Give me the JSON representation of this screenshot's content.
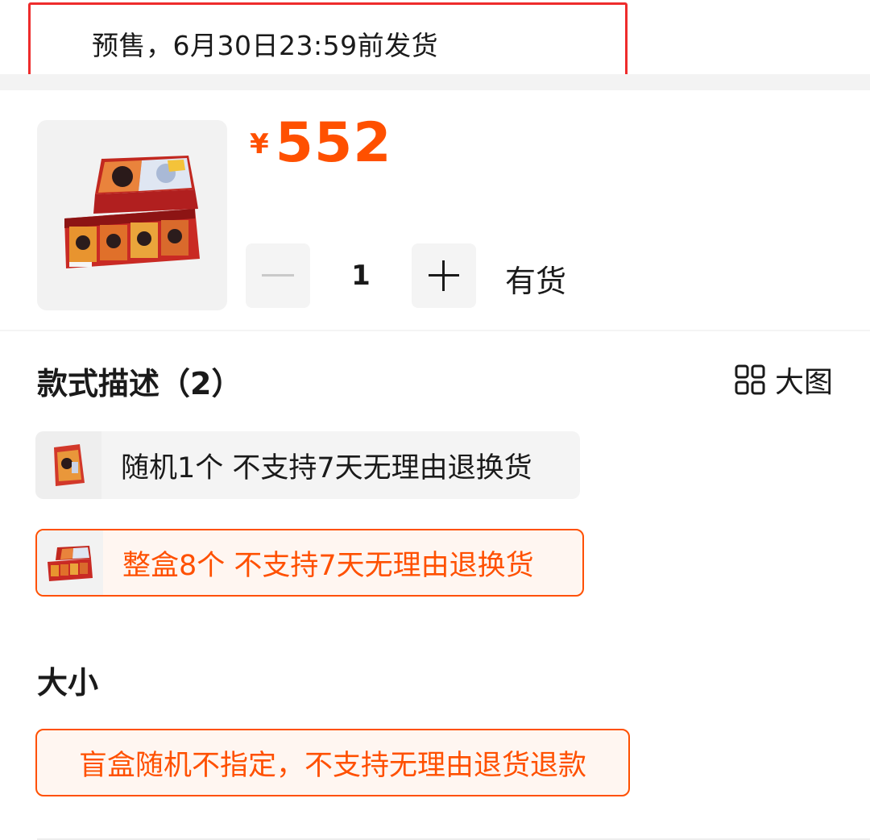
{
  "presale": {
    "text": "预售，6月30日23:59前发货"
  },
  "product": {
    "currency": "¥",
    "price": "552",
    "quantity": "1",
    "stock_status": "有货",
    "accent_color": "#ff5000"
  },
  "style_section": {
    "title": "款式描述（2）",
    "big_view_label": "大图",
    "big_view_icon": "grid-icon",
    "options": [
      {
        "label": "随机1个 不支持7天无理由退换货",
        "selected": false
      },
      {
        "label": "整盒8个 不支持7天无理由退换货",
        "selected": true
      }
    ]
  },
  "size_section": {
    "title": "大小",
    "options": [
      {
        "label": "盲盒随机不指定，不支持无理由退货退款",
        "selected": true
      }
    ]
  }
}
